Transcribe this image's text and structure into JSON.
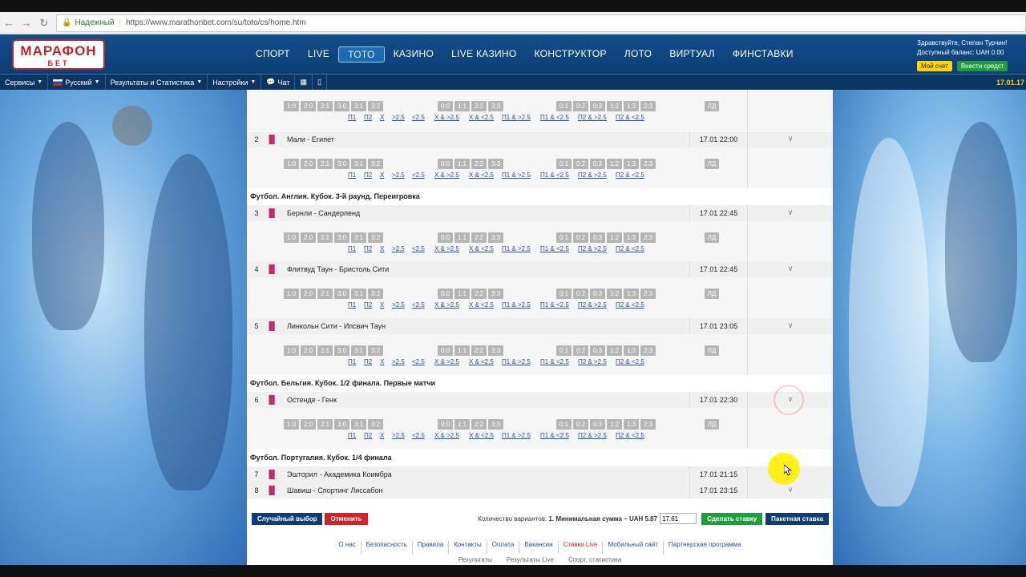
{
  "browser": {
    "secure_label": "Надежный",
    "url": "https://www.marathonbet.com/su/toto/cs/home.htm"
  },
  "header": {
    "logo_line1": "МАРАФОН",
    "logo_line2": "БЕТ",
    "nav": [
      "СПОРТ",
      "LIVE",
      "ТОТО",
      "КАЗИНО",
      "LIVE КАЗИНО",
      "КОНСТРУКТОР",
      "ЛОТО",
      "ВИРТУАЛ",
      "ФИНСТАВКИ"
    ],
    "active_nav": "ТОТО",
    "greeting": "Здравствуйте, Степан Турчин!",
    "balance": "Доступный баланс: UAH 0.00",
    "my_account": "Мой счет",
    "deposit": "Внести средст"
  },
  "toolbar": {
    "services": "Сервисы",
    "language": "Русский",
    "results": "Результаты и Статистика",
    "settings": "Настройки",
    "chat": "Чат",
    "date": "17.01.17"
  },
  "odds": {
    "group1": [
      "1:0",
      "2:0",
      "2:1",
      "3:0",
      "3:1",
      "3:2"
    ],
    "group2": [
      "0:0",
      "1:1",
      "2:2",
      "3:3"
    ],
    "group3": [
      "0:1",
      "0:2",
      "0:3",
      "1:2",
      "1:3",
      "2:3"
    ],
    "ld": "ЛД",
    "links": [
      "П1",
      "П2",
      "Х",
      ">2.5",
      "<2.5",
      "Х & >2.5",
      "Х & <2.5",
      "П1 & >2.5",
      "П1 & <2.5",
      "П2 & >2.5",
      "П2 & <2.5"
    ]
  },
  "leagues": {
    "l1": "Футбол. Англия. Кубок. 3-й раунд. Переигровка",
    "l2": "Футбол. Бельгия. Кубок. 1/2 финала. Первые матчи",
    "l3": "Футбол. Португалия. Кубок. 1/4 финала"
  },
  "matches": [
    {
      "num": "2",
      "name": "Мали - Египет",
      "time": "17.01 22:00"
    },
    {
      "num": "3",
      "name": "Бернли - Сандерленд",
      "time": "17.01 22:45"
    },
    {
      "num": "4",
      "name": "Флитвуд Таун - Бристоль Сити",
      "time": "17.01 22:45"
    },
    {
      "num": "5",
      "name": "Линкольн Сити - Ипсвич Таун",
      "time": "17.01 23:05"
    },
    {
      "num": "6",
      "name": "Остенде - Генк",
      "time": "17.01 22:30"
    },
    {
      "num": "7",
      "name": "Эшторил - Академика Коимбра",
      "time": "17.01 21:15"
    },
    {
      "num": "8",
      "name": "Шавиш - Спортинг Лиссабон",
      "time": "17.01 23:15"
    }
  ],
  "actions": {
    "random": "Случайный выбор",
    "cancel": "Отменить",
    "variants_label": "Количество вариантов:",
    "variants_value": "1.",
    "min_sum_label": "Минимальная сумма – UAH 5.87",
    "sum_value": "17.61",
    "place_bet": "Сделать ставку",
    "package_bet": "Пакетная ставка"
  },
  "footer": {
    "links": [
      "О нас",
      "Безопасность",
      "Правила",
      "Контакты",
      "Оплата",
      "Вакансии",
      "Ставки Live",
      "Мобильный сайт",
      "Партнерская программа"
    ],
    "links2": [
      "Результаты",
      "Результаты Live",
      "Спорт. статистика"
    ]
  }
}
